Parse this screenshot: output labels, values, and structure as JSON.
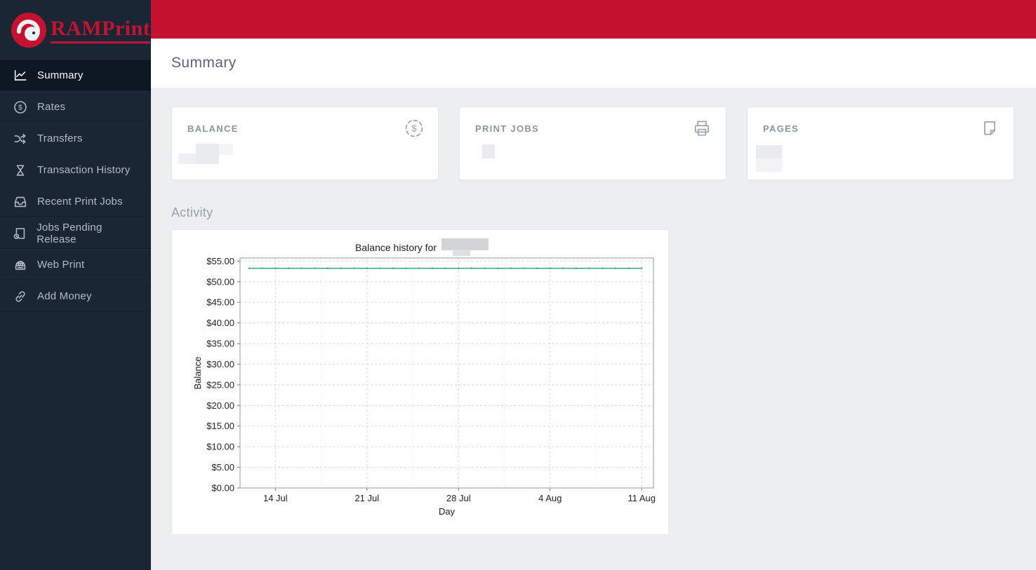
{
  "brand": {
    "name": "RAMPrint"
  },
  "colors": {
    "topbar_red": "#c51230",
    "sidebar_bg": "#1a2633",
    "sidebar_active_bg": "#0d1824",
    "line_green": "#2eb872"
  },
  "sidebar": {
    "items": [
      {
        "label": "Summary",
        "icon": "line-chart-icon",
        "active": true
      },
      {
        "label": "Rates",
        "icon": "dollar-circle-icon",
        "active": false
      },
      {
        "label": "Transfers",
        "icon": "shuffle-icon",
        "active": false
      },
      {
        "label": "Transaction History",
        "icon": "hourglass-icon",
        "active": false
      },
      {
        "label": "Recent Print Jobs",
        "icon": "inbox-tray-icon",
        "active": false
      },
      {
        "label": "Jobs Pending Release",
        "icon": "document-clock-icon",
        "active": false
      },
      {
        "label": "Web Print",
        "icon": "globe-printer-icon",
        "active": false
      },
      {
        "label": "Add Money",
        "icon": "link-icon",
        "active": false
      }
    ]
  },
  "header": {
    "title": "Summary"
  },
  "cards": [
    {
      "label": "BALANCE",
      "icon": "dollar-circle-dashed-icon",
      "value_redacted": true
    },
    {
      "label": "PRINT JOBS",
      "icon": "printer-icon",
      "value_redacted": true
    },
    {
      "label": "PAGES",
      "icon": "page-icon",
      "value_redacted": true
    }
  ],
  "activity": {
    "label": "Activity"
  },
  "chart_data": {
    "type": "line",
    "title": "Balance history for",
    "title_redacted": true,
    "xlabel": "Day",
    "ylabel": "Balance",
    "x_tick_labels": [
      "14 Jul",
      "21 Jul",
      "28 Jul",
      "4 Aug",
      "11 Aug"
    ],
    "x_tick_values": [
      14,
      21,
      28,
      35,
      42
    ],
    "x_minor_step": 3.5,
    "xlim": [
      11.3,
      42.9
    ],
    "y_tick_labels": [
      "$0.00",
      "$5.00",
      "$10.00",
      "$15.00",
      "$20.00",
      "$25.00",
      "$30.00",
      "$35.00",
      "$40.00",
      "$45.00",
      "$50.00",
      "$55.00"
    ],
    "y_tick_values": [
      0,
      5,
      10,
      15,
      20,
      25,
      30,
      35,
      40,
      45,
      50,
      55
    ],
    "ylim": [
      0,
      55
    ],
    "grid": true,
    "legend": false,
    "series": [
      {
        "name": "Balance",
        "color": "#2eb872",
        "x": [
          12,
          42
        ],
        "y": [
          53.25,
          53.25
        ]
      }
    ]
  }
}
